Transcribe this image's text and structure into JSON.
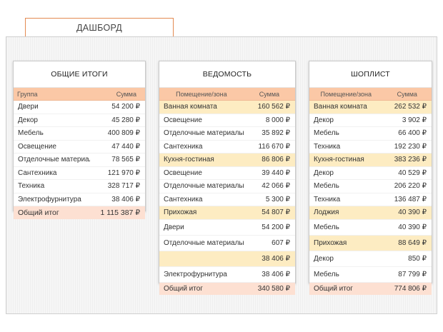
{
  "tab": {
    "label": "ДАШБОРД"
  },
  "cards": [
    {
      "title": "ОБЩИЕ ИТОГИ",
      "headers": [
        "Группа",
        "Сумма"
      ],
      "rows": [
        {
          "name": "Двери",
          "value": "54 200 ₽"
        },
        {
          "name": "Декор",
          "value": "45 280 ₽"
        },
        {
          "name": "Мебель",
          "value": "400 809 ₽"
        },
        {
          "name": "Освещение",
          "value": "47 440 ₽"
        },
        {
          "name": "Отделочные материалы",
          "value": "78 565 ₽"
        },
        {
          "name": "Сантехника",
          "value": "121 970 ₽"
        },
        {
          "name": "Техника",
          "value": "328 717 ₽"
        },
        {
          "name": "Электрофурнитура",
          "value": "38 406 ₽"
        }
      ],
      "total": {
        "name": "Общий итог",
        "value": "1 115 387 ₽"
      }
    },
    {
      "title": "ВЕДОМОСТЬ",
      "headers": [
        "Помещение/зона",
        "Сумма"
      ],
      "rows": [
        {
          "name": "Ванная комната",
          "value": "160 562 ₽",
          "zone": true
        },
        {
          "name": "Освещение",
          "value": "8 000 ₽"
        },
        {
          "name": "Отделочные материалы",
          "value": "35 892 ₽"
        },
        {
          "name": "Сантехника",
          "value": "116 670 ₽"
        },
        {
          "name": "Кухня-гостиная",
          "value": "86 806 ₽",
          "zone": true
        },
        {
          "name": "Освещение",
          "value": "39 440 ₽"
        },
        {
          "name": "Отделочные материалы",
          "value": "42 066 ₽"
        },
        {
          "name": "Сантехника",
          "value": "5 300 ₽"
        },
        {
          "name": "Прихожая",
          "value": "54 807 ₽",
          "zone": true
        },
        {
          "name": "Двери",
          "value": "54 200 ₽",
          "tall": true
        },
        {
          "name": "Отделочные материалы",
          "value": "607 ₽",
          "tall": true
        },
        {
          "name": "",
          "value": "38 406 ₽",
          "zone": true,
          "tall": true
        },
        {
          "name": "Электрофурнитура",
          "value": "38 406 ₽",
          "tall": true
        }
      ],
      "total": {
        "name": "Общий итог",
        "value": "340 580 ₽"
      }
    },
    {
      "title": "ШОПЛИСТ",
      "headers": [
        "Помещение/зона",
        "Сумма"
      ],
      "rows": [
        {
          "name": "Ванная комната",
          "value": "262 532 ₽",
          "zone": true
        },
        {
          "name": "Декор",
          "value": "3 902 ₽"
        },
        {
          "name": "Мебель",
          "value": "66 400 ₽"
        },
        {
          "name": "Техника",
          "value": "192 230 ₽"
        },
        {
          "name": "Кухня-гостиная",
          "value": "383 236 ₽",
          "zone": true
        },
        {
          "name": "Декор",
          "value": "40 529 ₽"
        },
        {
          "name": "Мебель",
          "value": "206 220 ₽"
        },
        {
          "name": "Техника",
          "value": "136 487 ₽"
        },
        {
          "name": "Лоджия",
          "value": "40 390 ₽",
          "zone": true
        },
        {
          "name": "Мебель",
          "value": "40 390 ₽",
          "tall": true
        },
        {
          "name": "Прихожая",
          "value": "88 649 ₽",
          "zone": true,
          "tall": true
        },
        {
          "name": "Декор",
          "value": "850 ₽",
          "tall": true
        },
        {
          "name": "Мебель",
          "value": "87 799 ₽",
          "tall": true
        }
      ],
      "total": {
        "name": "Общий итог",
        "value": "774 806 ₽"
      }
    }
  ]
}
